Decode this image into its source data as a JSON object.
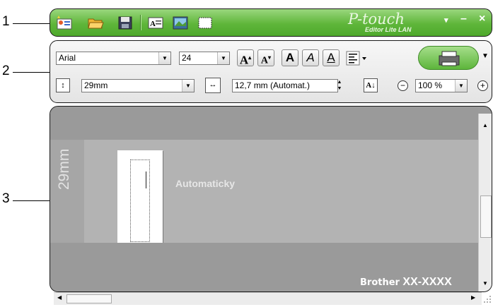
{
  "callouts": [
    {
      "number": "1"
    },
    {
      "number": "2"
    },
    {
      "number": "3"
    }
  ],
  "titlebar": {
    "icons": [
      "new-label-icon",
      "open-folder-icon",
      "save-icon",
      "text-icon",
      "image-icon",
      "frame-icon"
    ],
    "logo_script": "P-touch",
    "logo_sub": "Editor Lite LAN",
    "controls": [
      "▾",
      "–",
      "×"
    ],
    "accent_color": "#5fb63a"
  },
  "toolbar": {
    "font_name": "Arial",
    "font_size": "24",
    "tape_width": "29mm",
    "label_length": "12,7 mm (Automat.)",
    "zoom": "100 %",
    "zoom_out_label": "−",
    "zoom_in_label": "+",
    "buttons": {
      "grow": "A",
      "shrink": "A",
      "bold": "A",
      "italic": "A",
      "underline": "A"
    },
    "icons": [
      "tape-width-icon",
      "label-length-icon",
      "vertical-text-icon",
      "align-icon",
      "print-icon"
    ]
  },
  "canvas": {
    "tape_width_label": "29mm",
    "auto_label": "Automaticky",
    "model_brand": "Brother",
    "model_number": "XX-XXXX"
  }
}
